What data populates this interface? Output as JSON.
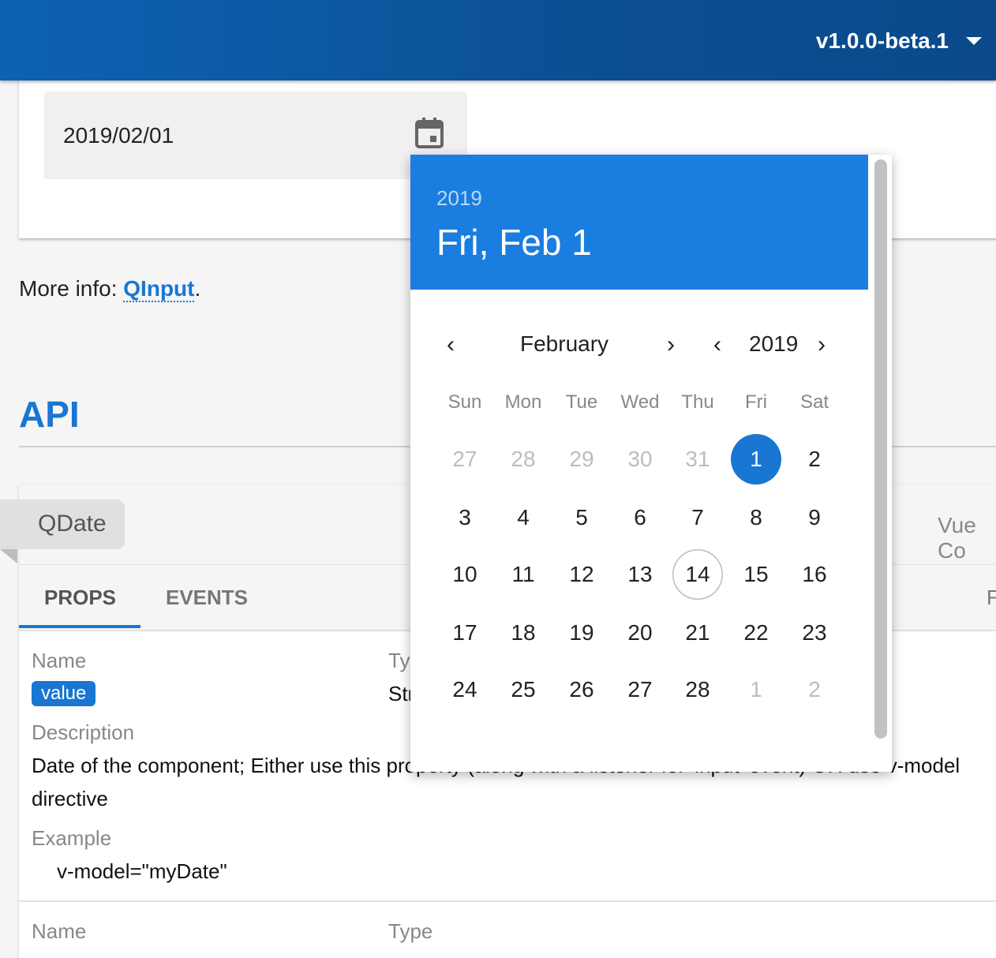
{
  "header": {
    "version": "v1.0.0-beta.1"
  },
  "demo": {
    "date_value": "2019/02/01"
  },
  "more_info": {
    "prefix": "More info: ",
    "link": "QInput",
    "suffix": "."
  },
  "api": {
    "title": "API",
    "component": "QDate",
    "vue_partial": "Vue Co",
    "tabs": [
      "PROPS",
      "EVENTS"
    ],
    "tab_partial": "F",
    "prop": {
      "name_label": "Name",
      "type_label": "Ty",
      "name": "value",
      "type": "Str",
      "description_label": "Description",
      "description_line1": "Date of the component; Either use this property (along with a listener for 'input' event) OR use v-model",
      "description_line2": "directive",
      "example_label": "Example",
      "example": "v-model=\"myDate\""
    },
    "next_row": {
      "name_label": "Name",
      "type_label": "Type"
    }
  },
  "picker": {
    "year": "2019",
    "date": "Fri, Feb 1",
    "month": "February",
    "nav_year": "2019",
    "weekdays": [
      "Sun",
      "Mon",
      "Tue",
      "Wed",
      "Thu",
      "Fri",
      "Sat"
    ],
    "days": [
      [
        "27",
        "28",
        "29",
        "30",
        "31",
        "1",
        "2"
      ],
      [
        "3",
        "4",
        "5",
        "6",
        "7",
        "8",
        "9"
      ],
      [
        "10",
        "11",
        "12",
        "13",
        "14",
        "15",
        "16"
      ],
      [
        "17",
        "18",
        "19",
        "20",
        "21",
        "22",
        "23"
      ],
      [
        "24",
        "25",
        "26",
        "27",
        "28",
        "1",
        "2"
      ]
    ],
    "selected_day": "1",
    "today_day": "14"
  },
  "colors": {
    "primary": "#1976d2",
    "header": "#0b4f93",
    "picker_head": "#1a7de0"
  }
}
